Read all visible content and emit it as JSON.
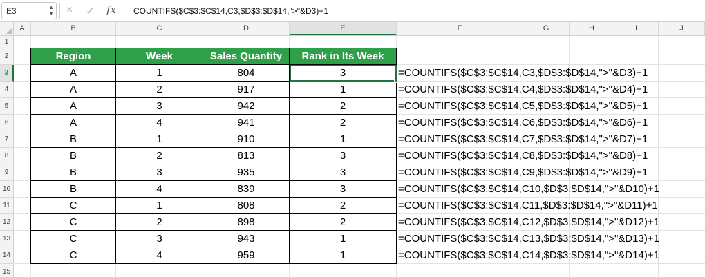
{
  "name_box": {
    "value": "E3",
    "stepper_icon": "chevron-up-down-icon"
  },
  "formula_bar": {
    "cancel_icon": "×",
    "confirm_icon": "✓",
    "fx_label": "fx",
    "formula": "=COUNTIFS($C$3:$C$14,C3,$D$3:$D$14,\">\"&D3)+1"
  },
  "columns": [
    "A",
    "B",
    "C",
    "D",
    "E",
    "F",
    "G",
    "H",
    "I",
    "J"
  ],
  "active_column": "E",
  "rows": [
    "1",
    "2",
    "3",
    "4",
    "5",
    "6",
    "7",
    "8",
    "9",
    "10",
    "11",
    "12",
    "13",
    "14",
    "15"
  ],
  "active_row": "3",
  "table": {
    "headers": [
      "Region",
      "Week",
      "Sales Quantity",
      "Rank in Its Week"
    ],
    "header_color": "#2fa04a",
    "data": [
      [
        "A",
        "1",
        "804",
        "3"
      ],
      [
        "A",
        "2",
        "917",
        "1"
      ],
      [
        "A",
        "3",
        "942",
        "2"
      ],
      [
        "A",
        "4",
        "941",
        "2"
      ],
      [
        "B",
        "1",
        "910",
        "1"
      ],
      [
        "B",
        "2",
        "813",
        "3"
      ],
      [
        "B",
        "3",
        "935",
        "3"
      ],
      [
        "B",
        "4",
        "839",
        "3"
      ],
      [
        "C",
        "1",
        "808",
        "2"
      ],
      [
        "C",
        "2",
        "898",
        "2"
      ],
      [
        "C",
        "3",
        "943",
        "1"
      ],
      [
        "C",
        "4",
        "959",
        "1"
      ]
    ]
  },
  "formulas": [
    "=COUNTIFS($C$3:$C$14,C3,$D$3:$D$14,\">\"&D3)+1",
    "=COUNTIFS($C$3:$C$14,C4,$D$3:$D$14,\">\"&D4)+1",
    "=COUNTIFS($C$3:$C$14,C5,$D$3:$D$14,\">\"&D5)+1",
    "=COUNTIFS($C$3:$C$14,C6,$D$3:$D$14,\">\"&D6)+1",
    "=COUNTIFS($C$3:$C$14,C7,$D$3:$D$14,\">\"&D7)+1",
    "=COUNTIFS($C$3:$C$14,C8,$D$3:$D$14,\">\"&D8)+1",
    "=COUNTIFS($C$3:$C$14,C9,$D$3:$D$14,\">\"&D9)+1",
    "=COUNTIFS($C$3:$C$14,C10,$D$3:$D$14,\">\"&D10)+1",
    "=COUNTIFS($C$3:$C$14,C11,$D$3:$D$14,\">\"&D11)+1",
    "=COUNTIFS($C$3:$C$14,C12,$D$3:$D$14,\">\"&D12)+1",
    "=COUNTIFS($C$3:$C$14,C13,$D$3:$D$14,\">\"&D13)+1",
    "=COUNTIFS($C$3:$C$14,C14,$D$3:$D$14,\">\"&D14)+1"
  ],
  "accent_color": "#217346"
}
